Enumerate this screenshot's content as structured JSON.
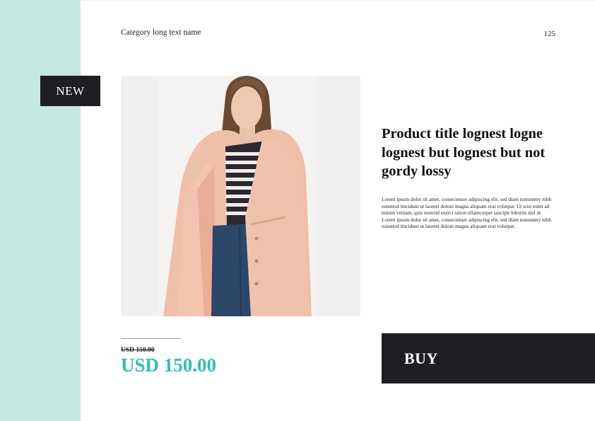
{
  "header": {
    "category": "Category long text name",
    "page_number": "125"
  },
  "badge": {
    "label": "NEW"
  },
  "product": {
    "title": "Product title lognest logne lognest but lognest but not gordy lossy",
    "description": "Lorem ipsum dolor sit amet, consectetuer adipiscing elit, sed diam nonummy nibh euismod tincidunt ut laoreet dolore magna aliquam erat volutpat. Ut wisi enim ad minim veniam, quis nostrud exerci tation ullamcorper suscipit lobortis nisl ut Lorem ipsum dolor sit amet, consectetuer adipiscing elit, sed diam nonummy nibh euismod tincidunt ut laoreet dolore magna aliquam erat volutpat.",
    "image": "woman-in-pink-parka-photo"
  },
  "pricing": {
    "old_price": "USD 150.00",
    "price": "USD 150.00"
  },
  "buy_button": {
    "label": "BUY"
  },
  "colors": {
    "side_band": "#c3e8e2",
    "dark": "#1f1e23",
    "accent_price": "#2fbfb0"
  }
}
